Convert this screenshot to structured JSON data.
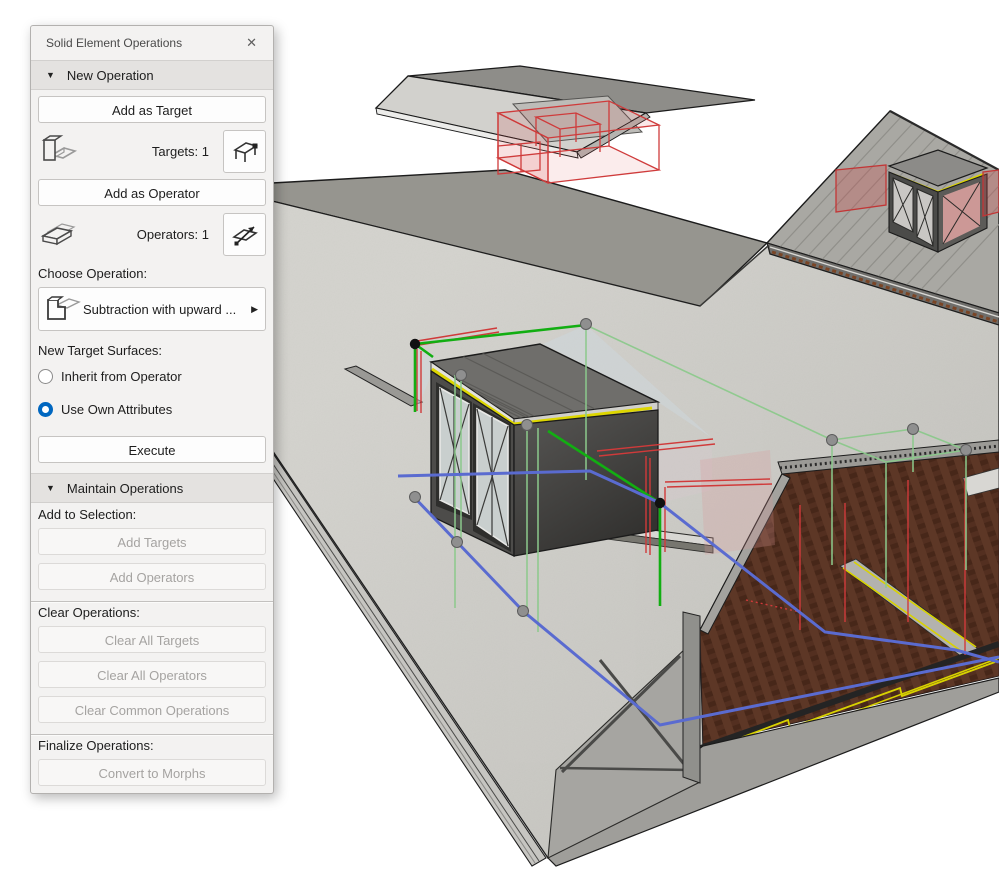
{
  "palette": {
    "title": "Solid Element Operations",
    "new_operation": {
      "header": "New Operation",
      "add_as_target": "Add as Target",
      "targets_count_label": "Targets: 1",
      "add_as_operator": "Add as Operator",
      "operators_count_label": "Operators: 1",
      "choose_operation_label": "Choose Operation:",
      "operation_value": "Subtraction with upward ...",
      "new_target_surfaces_label": "New Target Surfaces:",
      "radio_inherit_label": "Inherit from Operator",
      "radio_use_own_label": "Use Own Attributes",
      "selected_option": "Use Own Attributes",
      "execute": "Execute"
    },
    "maintain": {
      "header": "Maintain Operations",
      "add_to_selection_label": "Add to Selection:",
      "add_targets": "Add Targets",
      "add_operators": "Add Operators",
      "clear_operations_label": "Clear Operations:",
      "clear_all_targets": "Clear All Targets",
      "clear_all_operators": "Clear All Operators",
      "clear_common_operations": "Clear Common Operations",
      "finalize_operations_label": "Finalize Operations:",
      "convert_to_morphs": "Convert to Morphs"
    },
    "icons": {
      "close_glyph": "✕",
      "collapse_glyph": "▼",
      "flyout_glyph": "▶"
    }
  },
  "viewport": {
    "colors": {
      "selection_green": "#12ae12",
      "selection_green_pale": "#8cc98c",
      "operator_red": "#d03a3a",
      "guide_blue": "#5a6bd0",
      "edge_yellow": "#ddd600",
      "roof_front": "#cbc9c4",
      "roof_back": "#96958f",
      "right_roof": "#a9a8a3",
      "interior_wood": "#3e2c1e",
      "background": "#ffffff"
    }
  }
}
